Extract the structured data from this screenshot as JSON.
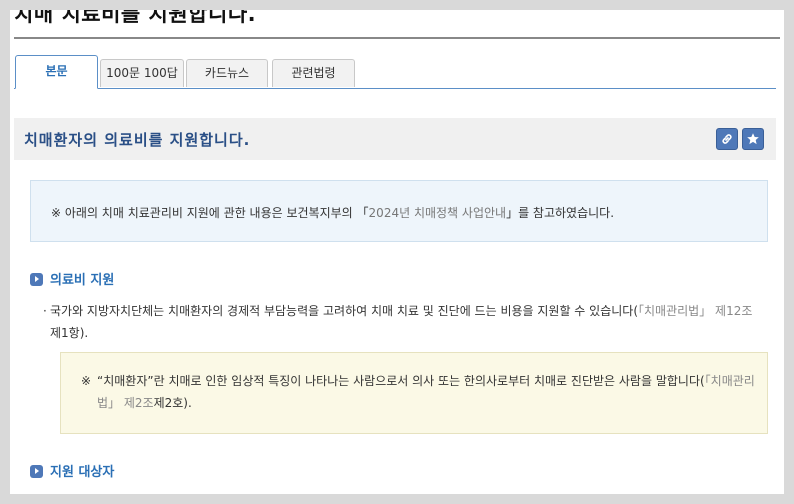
{
  "page": {
    "title": "치매 치료비를 지원합니다."
  },
  "tabs": [
    {
      "label": "본문",
      "active": true
    },
    {
      "label": "100문 100답",
      "active": false
    },
    {
      "label": "카드뉴스",
      "active": false
    },
    {
      "label": "관련법령",
      "active": false
    }
  ],
  "section": {
    "title": "치매환자의 의료비를 지원합니다.",
    "icons": [
      "link-icon",
      "star-icon"
    ],
    "accent_color": "#4e78b8"
  },
  "notice": {
    "prefix": "※ 아래의 치매 치료관리비 지원에 관한 내용은 보건복지부의 「",
    "ref": "2024년 치매정책 사업안내",
    "suffix": "」를 참고하였습니다."
  },
  "medical_support": {
    "heading": "의료비 지원",
    "paragraph_main": "국가와 지방자치단체는 치매환자의 경제적 부담능력을 고려하여 치매 치료 및 진단에 드는 비용을 지원할 수 있습니다(",
    "paragraph_ref": "「치매관리법」 제12조",
    "paragraph_ref_tail": "제1항).",
    "note_mark": "※",
    "note_main": "“치매환자”란 치매로 인한 임상적 특징이 나타나는 사람으로서 의사 또는 한의사로부터 치매로 진단받은 사람을 말합니다(",
    "note_ref": "「치매관리법」 제2조",
    "note_ref_tail": "제2호)."
  },
  "target": {
    "heading": "지원 대상자"
  }
}
